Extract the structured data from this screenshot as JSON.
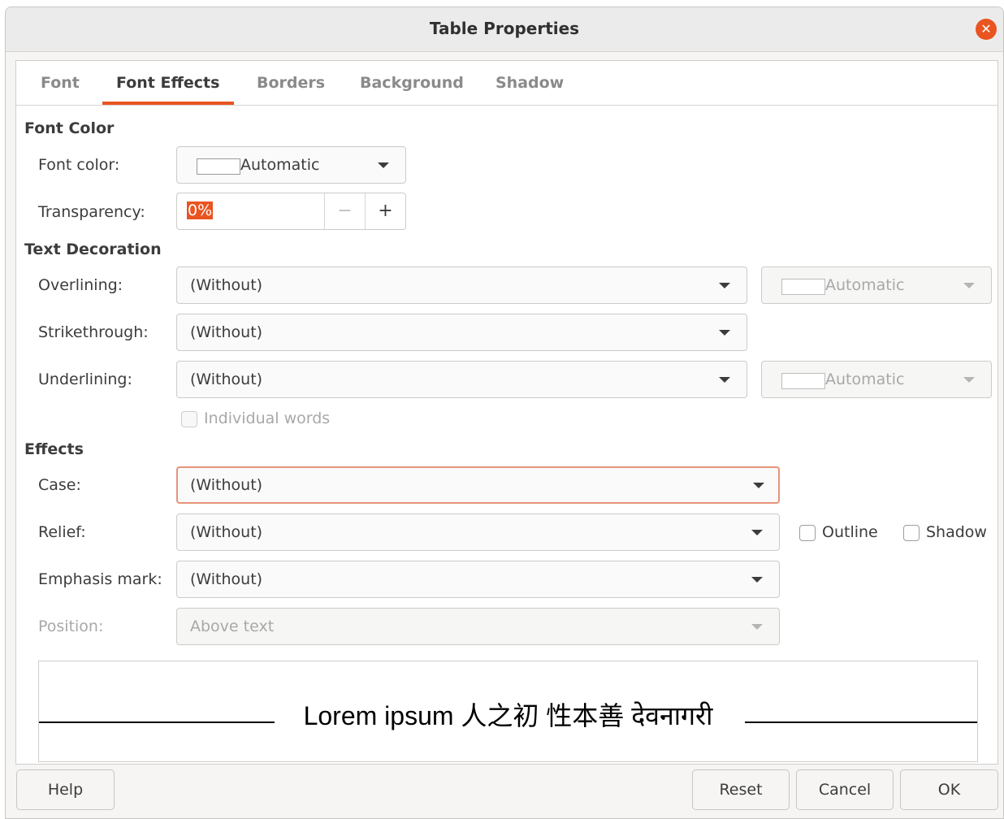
{
  "window": {
    "title": "Table Properties"
  },
  "tabs": [
    {
      "label": "Font"
    },
    {
      "label": "Font Effects"
    },
    {
      "label": "Borders"
    },
    {
      "label": "Background"
    },
    {
      "label": "Shadow"
    }
  ],
  "active_tab": "Font Effects",
  "font_color": {
    "section": "Font Color",
    "color_label": "Font color:",
    "color_value": "Automatic",
    "transparency_label": "Transparency:",
    "transparency_value": "0%",
    "minus": "−",
    "plus": "+"
  },
  "text_decoration": {
    "section": "Text Decoration",
    "overlining_label": "Overlining:",
    "overlining_value": "(Without)",
    "overline_color": "Automatic",
    "strikethrough_label": "Strikethrough:",
    "strikethrough_value": "(Without)",
    "underlining_label": "Underlining:",
    "underlining_value": "(Without)",
    "underline_color": "Automatic",
    "individual_words": "Individual words"
  },
  "effects": {
    "section": "Effects",
    "case_label": "Case:",
    "case_value": "(Without)",
    "relief_label": "Relief:",
    "relief_value": "(Without)",
    "outline": "Outline",
    "shadow": "Shadow",
    "emphasis_label": "Emphasis mark:",
    "emphasis_value": "(Without)",
    "position_label": "Position:",
    "position_value": "Above text"
  },
  "preview": {
    "text": "Lorem ipsum   人之初 性本善  देवनागरी"
  },
  "buttons": {
    "help": "Help",
    "reset": "Reset",
    "cancel": "Cancel",
    "ok": "OK"
  },
  "colors": {
    "accent": "#e95420",
    "focus_border": "#e8937a"
  }
}
